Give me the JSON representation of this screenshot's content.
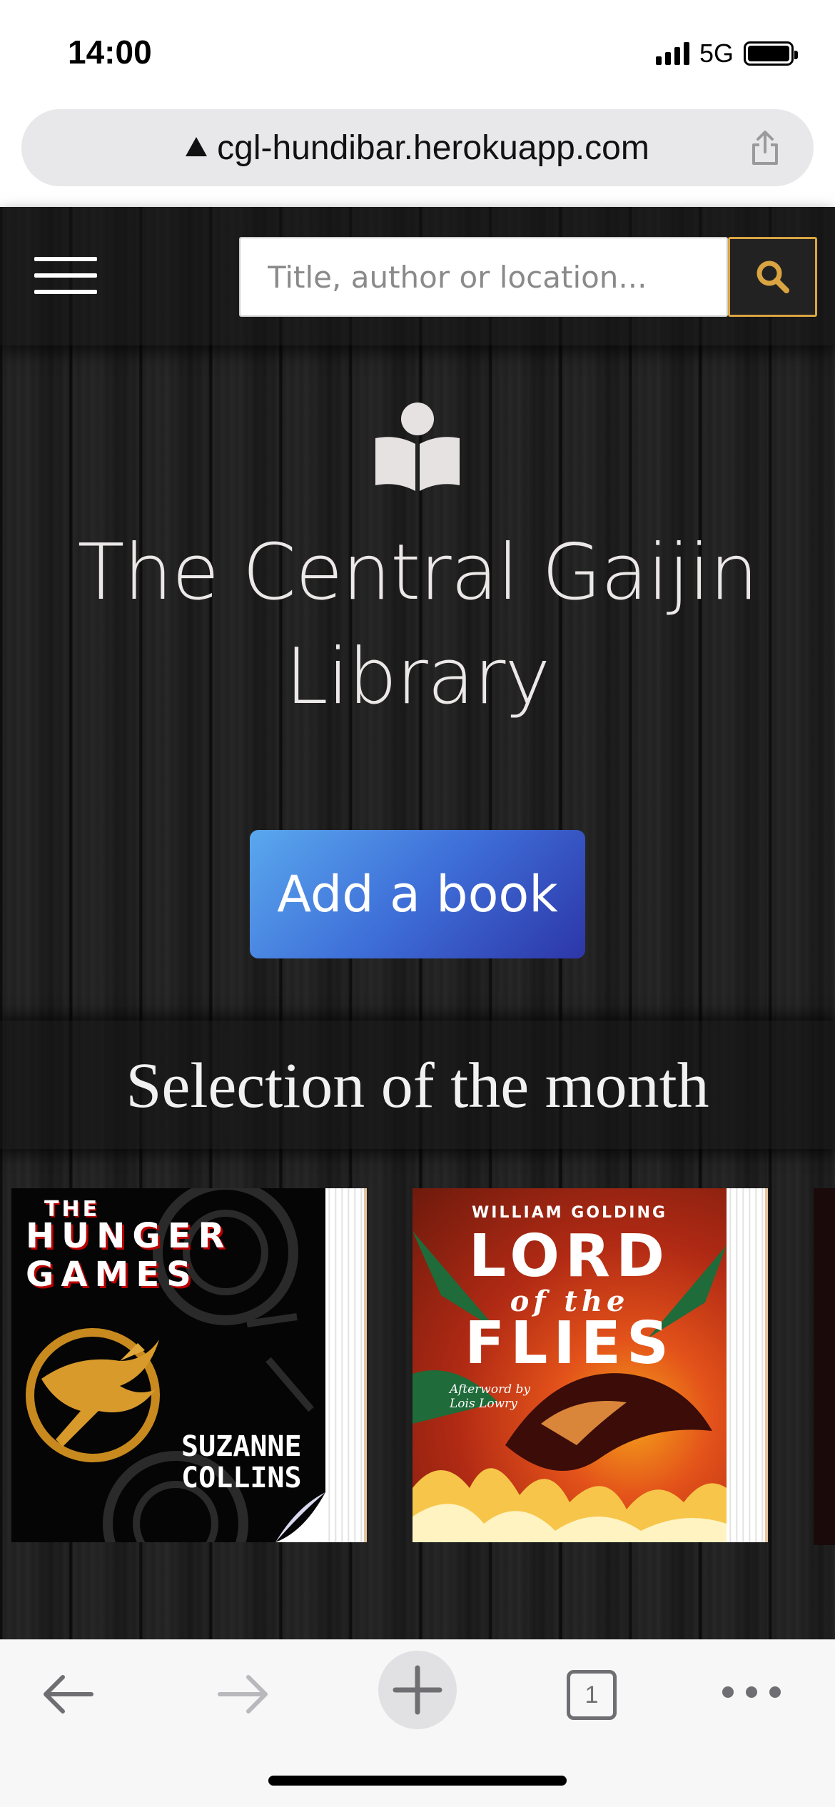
{
  "status_bar": {
    "time": "14:00",
    "network": "5G"
  },
  "browser": {
    "url": "cgl-hundibar.herokuapp.com",
    "tab_count": "1"
  },
  "navbar": {
    "search_placeholder": "Title, author or location..."
  },
  "hero": {
    "title": "The Central Gaijin Library",
    "add_button_label": "Add a book"
  },
  "section": {
    "title": "Selection of the month"
  },
  "books": [
    {
      "title_small": "THE",
      "title_big": "HUNGER\nGAMES",
      "author": "SUZANNE\nCOLLINS"
    },
    {
      "author": "WILLIAM GOLDING",
      "title_line1": "LORD",
      "title_line2": "of the",
      "title_line3": "FLIES",
      "afterword": "Afterword by\nLois Lowry"
    }
  ],
  "colors": {
    "accent_gold": "#d9a441",
    "button_blue": "#3e6ed8",
    "background": "#1d1d1d"
  }
}
